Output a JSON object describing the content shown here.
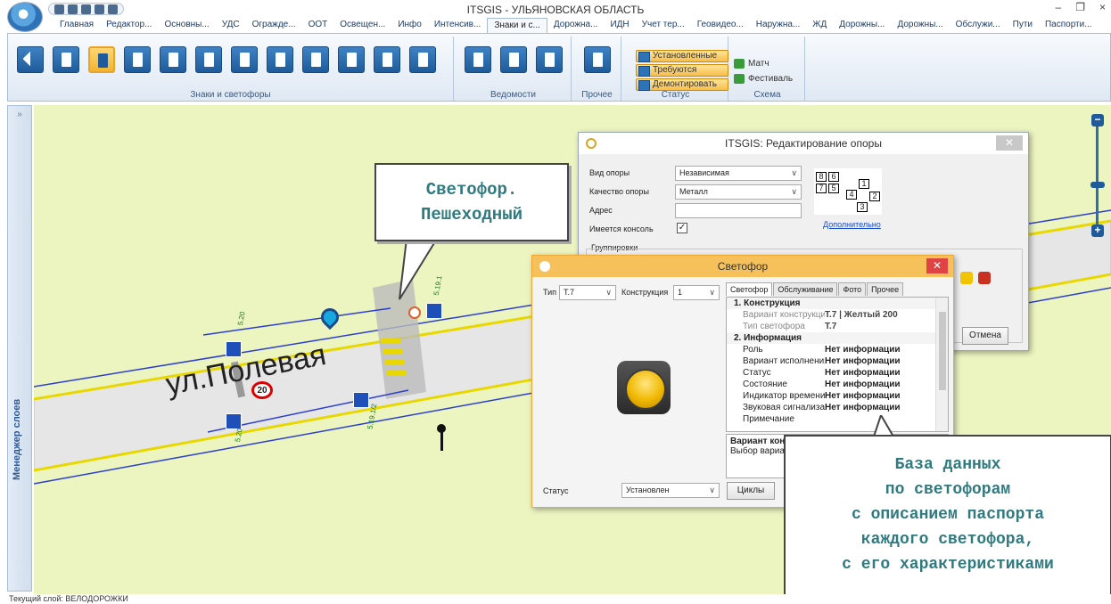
{
  "window": {
    "title": "ITSGIS - УЛЬЯНОВСКАЯ ОБЛАСТЬ",
    "controls": [
      "–",
      "❐",
      "×"
    ]
  },
  "ribbon": {
    "tabs": [
      "Главная",
      "Редактор...",
      "Основны...",
      "УДС",
      "Огражде...",
      "ООТ",
      "Освещен...",
      "Инфо",
      "Интенсив...",
      "Знаки и с...",
      "Дорожна...",
      "ИДН",
      "Учет тер...",
      "Геовидео...",
      "Наружна...",
      "ЖД",
      "Дорожны...",
      "Дорожны...",
      "Обслужи...",
      "Пути",
      "Паспорти..."
    ],
    "active_tab": "Знаки и с...",
    "groups": {
      "signs": "Знаки и светофоры",
      "statements": "Ведомости",
      "other": "Прочее",
      "status": "Статус",
      "scheme": "Схема"
    },
    "status_buttons": [
      "Установленные",
      "Требуются",
      "Демонтировать"
    ],
    "scheme_items": [
      "Матч",
      "Фестиваль"
    ]
  },
  "side_panel": {
    "label": "Менеджер слоев"
  },
  "map": {
    "street_label": "ул.Полевая",
    "speed_sign": "20",
    "sign_labels": [
      "5.20",
      "5.20",
      "5.19.1",
      "5.19.1/2"
    ],
    "zoom_in": "+",
    "zoom_out": "−"
  },
  "support_dialog": {
    "title": "ITSGIS: Редактирование опоры",
    "fields": {
      "type_label": "Вид опоры",
      "type_value": "Независимая",
      "quality_label": "Качество опоры",
      "quality_value": "Металл",
      "address_label": "Адрес",
      "address_value": "",
      "console_label": "Имеется консоль",
      "console_checked": "✓"
    },
    "link": "Дополнительно",
    "groups_label": "Группировки",
    "cancel": "Отмена",
    "diagram_numbers": [
      "8",
      "6",
      "7",
      "5",
      "4",
      "1",
      "2",
      "3"
    ]
  },
  "light_dialog": {
    "title": "Светофор",
    "type_label": "Тип",
    "type_value": "Т.7",
    "construction_label": "Конструкция",
    "construction_value": "1",
    "tabs": [
      "Светофор",
      "Обслуживание",
      "Фото",
      "Прочее"
    ],
    "grid": [
      {
        "kind": "cat",
        "k": "1. Конструкция"
      },
      {
        "kind": "dim",
        "k": "Вариант конструкции",
        "v": "Т.7 | Желтый 200"
      },
      {
        "kind": "dim",
        "k": "Тип светофора",
        "v": "Т.7"
      },
      {
        "kind": "cat",
        "k": "2. Информация"
      },
      {
        "kind": "row",
        "k": "Роль",
        "v": "Нет информации"
      },
      {
        "kind": "row",
        "k": "Вариант исполнения",
        "v": "Нет информации"
      },
      {
        "kind": "row",
        "k": "Статус",
        "v": "Нет информации"
      },
      {
        "kind": "row",
        "k": "Состояние",
        "v": "Нет информации"
      },
      {
        "kind": "row",
        "k": "Индикатор времени",
        "v": "Нет информации"
      },
      {
        "kind": "row",
        "k": "Звуковая сигнализация",
        "v": "Нет информации"
      },
      {
        "kind": "row",
        "k": "Примечание",
        "v": ""
      }
    ],
    "desc_title": "Вариант конструкции",
    "desc_text": "Выбор варианта",
    "status_label": "Статус",
    "status_value": "Установлен",
    "cycles_button": "Циклы"
  },
  "callouts": {
    "top": [
      "Светофор.",
      "Пешеходный"
    ],
    "bottom": [
      "База данных",
      "по светофорам",
      "с описанием паспорта",
      "каждого светофора,",
      "с его характеристиками"
    ]
  },
  "statusbar": {
    "text": "Текущий слой: ВЕЛОДОРОЖКИ"
  }
}
